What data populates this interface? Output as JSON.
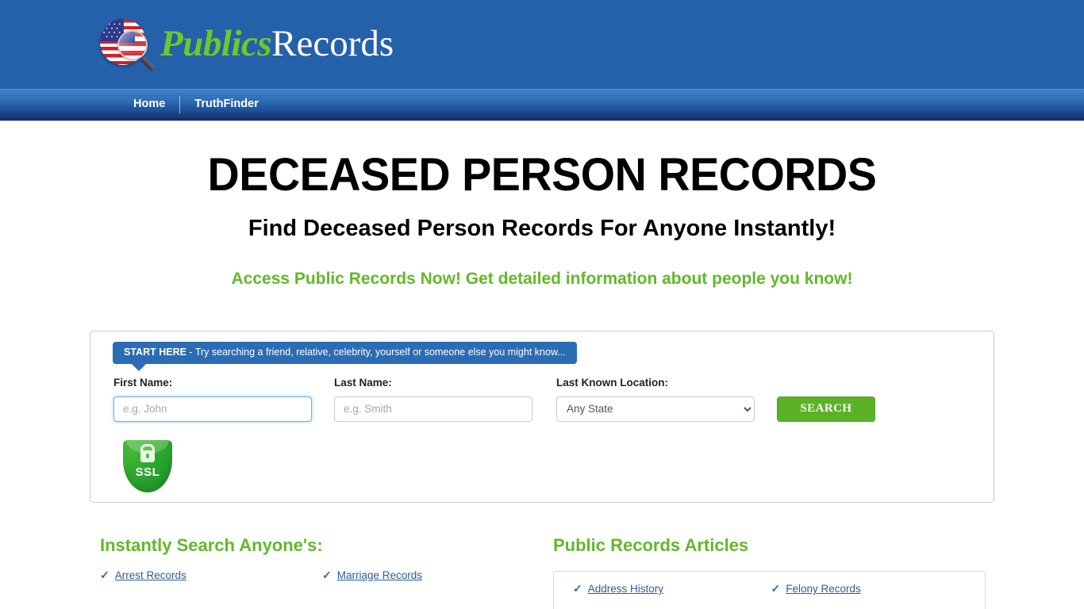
{
  "header": {
    "logo": {
      "icon": "usa-flag-magnifier-icon",
      "text_green": "Publics",
      "text_white": "Records"
    }
  },
  "nav": {
    "items": [
      {
        "label": "Home"
      },
      {
        "label": "TruthFinder"
      }
    ]
  },
  "hero": {
    "title": "DECEASED PERSON RECORDS",
    "subtitle": "Find Deceased Person Records For Anyone Instantly!",
    "tagline": "Access Public Records Now! Get detailed information about people you know!"
  },
  "search": {
    "callout_strong": "START HERE",
    "callout_rest": " - Try searching a friend, relative, celebrity, yourself or someone else you might know...",
    "first_name": {
      "label": "First Name:",
      "placeholder": "e.g. John",
      "value": ""
    },
    "last_name": {
      "label": "Last Name:",
      "placeholder": "e.g. Smith",
      "value": ""
    },
    "location": {
      "label": "Last Known Location:",
      "selected": "Any State",
      "options": [
        "Any State"
      ]
    },
    "submit_label": "SEARCH",
    "ssl_badge": {
      "icon": "ssl-shield-lock-icon",
      "text": "SSL"
    }
  },
  "sections": {
    "instant_search": {
      "title": "Instantly Search Anyone's:",
      "links": [
        {
          "label": "Arrest Records"
        },
        {
          "label": "Marriage Records"
        }
      ]
    },
    "articles": {
      "title": "Public Records Articles",
      "links": [
        {
          "label": "Address History"
        },
        {
          "label": "Felony Records"
        }
      ]
    }
  },
  "colors": {
    "header_blue": "#2560ab",
    "nav_blue_top": "#3d83c9",
    "nav_blue_bottom": "#16326d",
    "accent_green": "#62b82a",
    "button_green": "#5cb226",
    "link_blue": "#2b5d99"
  },
  "glyphs": {
    "check": "✓"
  }
}
